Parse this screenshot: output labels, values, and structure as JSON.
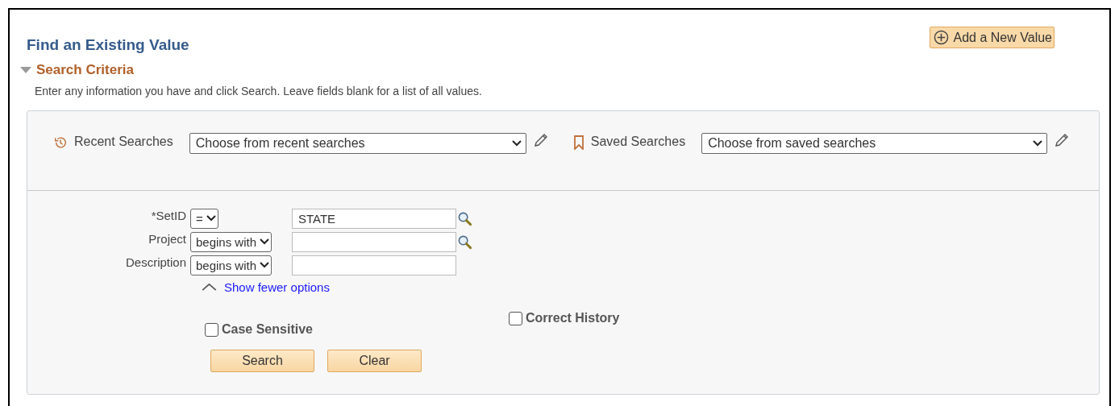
{
  "page_title": "Find an Existing Value",
  "add_button": "Add a New Value",
  "section": {
    "title": "Search Criteria",
    "expanded": true
  },
  "instructions": "Enter any information you have and click Search. Leave fields blank for a list of all values.",
  "recent": {
    "label": "Recent Searches",
    "placeholder": "Choose from recent searches"
  },
  "saved": {
    "label": "Saved Searches",
    "placeholder": "Choose from saved searches"
  },
  "criteria": [
    {
      "label": "*SetID",
      "operator": "=",
      "value": "STATE",
      "lookup": true
    },
    {
      "label": "Project",
      "operator": "begins with",
      "lookup": true
    },
    {
      "label": "Description",
      "operator": "begins with",
      "lookup": false
    }
  ],
  "options_link": "Show fewer options",
  "checkboxes": [
    {
      "label": "Case Sensitive",
      "checked": false
    },
    {
      "label": "Correct History",
      "checked": false
    }
  ],
  "buttons": [
    "Search",
    "Clear"
  ]
}
